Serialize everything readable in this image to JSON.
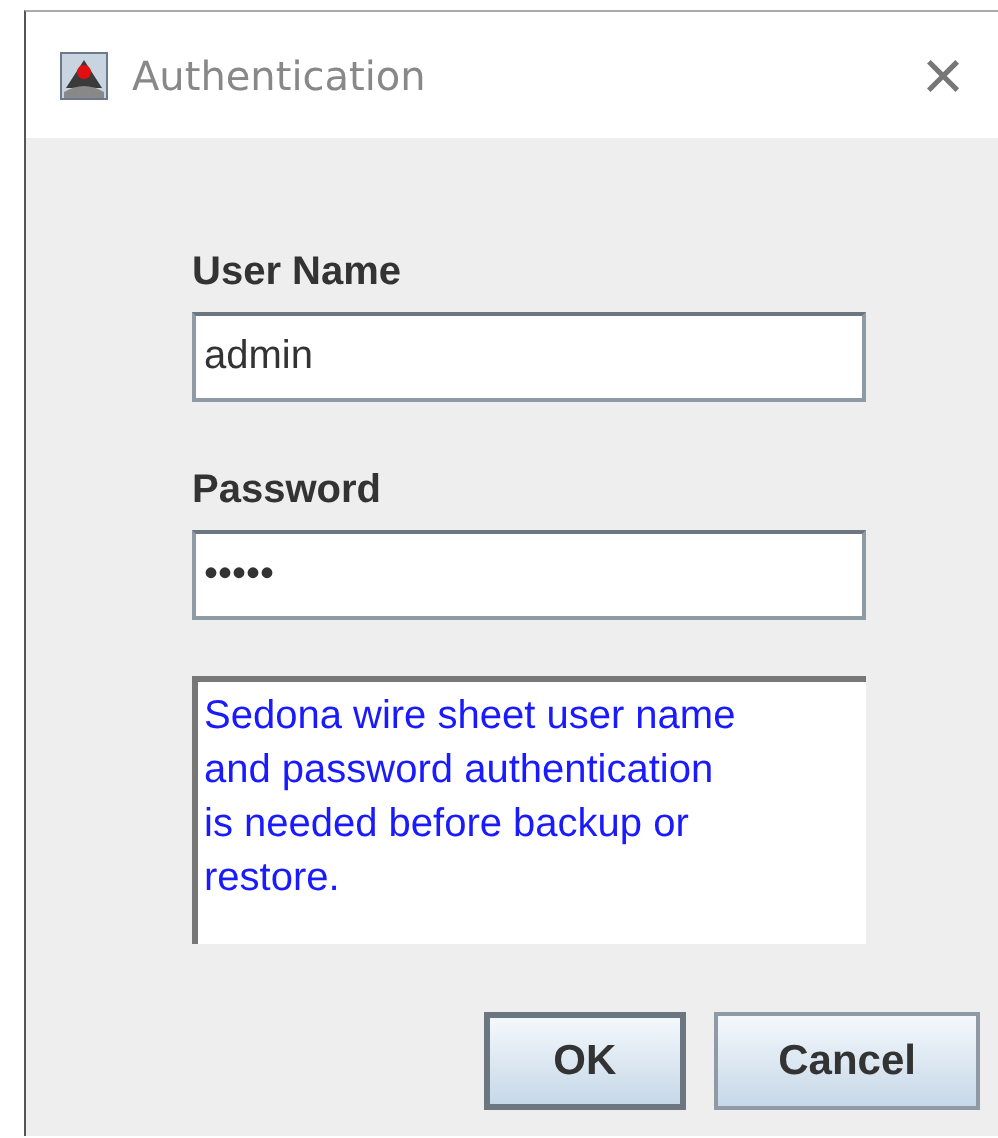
{
  "window": {
    "title": "Authentication",
    "close": "×"
  },
  "fields": [
    {
      "label": "User Name",
      "value": "admin"
    },
    {
      "label": "Password",
      "value": "•••••"
    }
  ],
  "message": "Sedona wire sheet user name and password authentication is needed before backup or restore.",
  "buttons": [
    {
      "label": "OK",
      "default": true
    },
    {
      "label": "Cancel",
      "default": false
    }
  ]
}
